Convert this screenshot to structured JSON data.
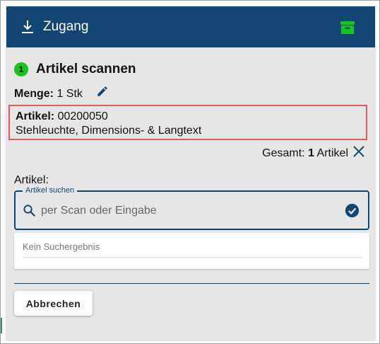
{
  "header": {
    "title": "Zugang",
    "download_icon": "download-icon",
    "archive_icon": "archive-icon",
    "archive_color": "#16c51a",
    "background": "#124672"
  },
  "step": {
    "number": "1",
    "label": "Artikel scannen",
    "badge_color": "#16c51a"
  },
  "menge": {
    "label": "Menge:",
    "value": "1 Stk",
    "edit_icon": "pencil-icon"
  },
  "artikel_info": {
    "label": "Artikel:",
    "number": "00200050",
    "description": "Stehleuchte, Dimensions- & Langtext",
    "border_color": "#e05a5a"
  },
  "gesamt": {
    "label": "Gesamt:",
    "count": "1",
    "unit": "Artikel",
    "close_icon": "close-icon"
  },
  "search": {
    "section_label": "Artikel:",
    "legend": "Artikel suchen",
    "placeholder": "per Scan oder Eingabe",
    "value": "",
    "search_icon": "search-icon",
    "confirm_icon": "check-circle-icon"
  },
  "results": {
    "empty_text": "Kein Suchergebnis"
  },
  "actions": {
    "cancel_label": "Abbrechen"
  }
}
